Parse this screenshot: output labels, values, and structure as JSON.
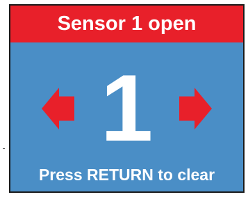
{
  "alert": {
    "title": "Sensor 1 open",
    "sensor_number": "1",
    "instruction": "Press RETURN to clear"
  },
  "colors": {
    "header_background": "#e8202a",
    "panel_background": "#4a8ec6",
    "arrow_color": "#e8202a",
    "text_color": "#ffffff"
  },
  "icons": {
    "left": "arrow-left-icon",
    "right": "arrow-right-icon"
  }
}
